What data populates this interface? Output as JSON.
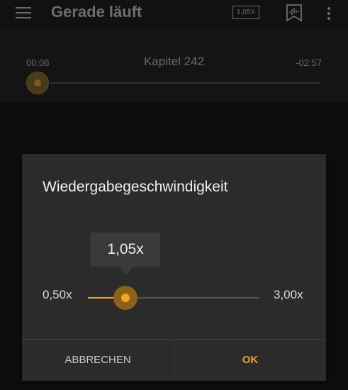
{
  "app_bar": {
    "title": "Gerade läuft",
    "speed_badge": "1,05X",
    "icons": [
      "menu-icon",
      "bookmark-waveform-icon",
      "more-vert-icon"
    ]
  },
  "player": {
    "elapsed": "00:06",
    "chapter": "Kapitel 242",
    "remaining": "-02:57"
  },
  "dialog": {
    "title": "Wiedergabegeschwindigkeit",
    "current_value": "1,05x",
    "min_label": "0,50x",
    "max_label": "3,00x",
    "slider_min": 0.5,
    "slider_max": 3.0,
    "slider_value": 1.05,
    "cancel_label": "ABBRECHEN",
    "ok_label": "OK"
  },
  "colors": {
    "accent": "#f0a12a",
    "background": "#0d0d0d",
    "dialog_background": "#2b2b2b"
  }
}
